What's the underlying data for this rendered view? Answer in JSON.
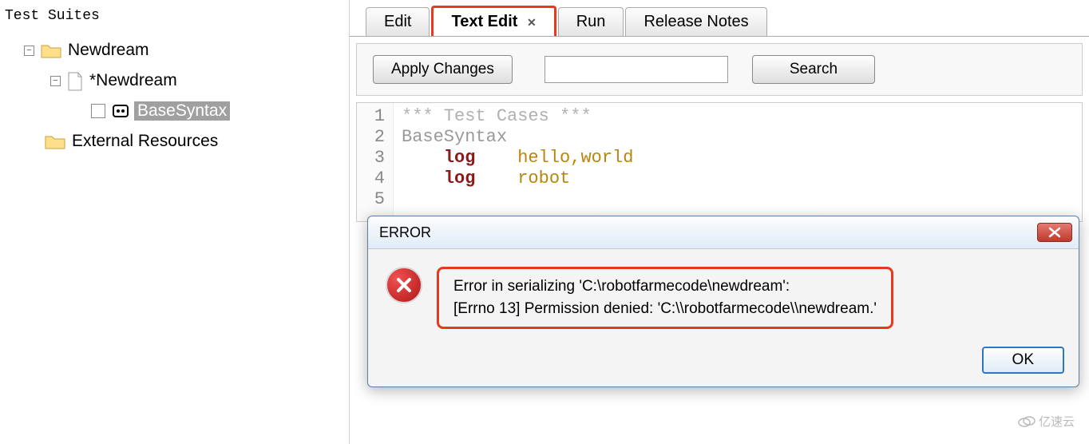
{
  "sidebar": {
    "title": "Test Suites",
    "nodes": {
      "root": {
        "label": "Newdream"
      },
      "child": {
        "label": "*Newdream"
      },
      "leaf": {
        "label": "BaseSyntax"
      },
      "ext": {
        "label": "External Resources"
      }
    }
  },
  "tabs": [
    {
      "label": "Edit",
      "active": false
    },
    {
      "label": "Text Edit",
      "active": true,
      "closable": true
    },
    {
      "label": "Run",
      "active": false
    },
    {
      "label": "Release Notes",
      "active": false
    }
  ],
  "toolbar": {
    "apply_label": "Apply Changes",
    "search_label": "Search"
  },
  "editor": {
    "lines": [
      "1",
      "2",
      "3",
      "4",
      "5"
    ],
    "code": {
      "l1a": "*** ",
      "l1b": "Test Cases",
      "l1c": " ***",
      "l2": "BaseSyntax",
      "l3kw": "log",
      "l3arg": "hello,world",
      "l4kw": "log",
      "l4arg": "robot"
    }
  },
  "dialog": {
    "title": "ERROR",
    "line1": "Error in serializing 'C:\\robotfarmecode\\newdream':",
    "line2": "[Errno 13] Permission denied: 'C:\\\\robotfarmecode\\\\newdream.'",
    "ok_label": "OK"
  },
  "watermark": "亿速云"
}
